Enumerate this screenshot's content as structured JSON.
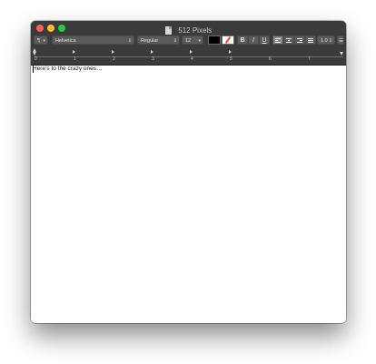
{
  "window": {
    "title": "512 Pixels",
    "title_icon": "document-icon"
  },
  "toolbar": {
    "paragraph_style_label": "¶",
    "font_family": "Helvetica",
    "font_style": "Regular",
    "font_size": "12",
    "text_color": "#000000",
    "background_color": "none",
    "bold_label": "B",
    "italic_label": "I",
    "underline_label": "U",
    "alignment_selected": "left",
    "line_spacing": "1.0",
    "list_style_icon": "list-icon"
  },
  "ruler": {
    "numbers": [
      "0",
      "1",
      "2",
      "3",
      "4",
      "5",
      "6",
      "7"
    ]
  },
  "document": {
    "text": "Here’s to the crazy ones…"
  },
  "colors": {
    "titlebar": "#3b3b3b",
    "close": "#fe5f57",
    "minimize": "#febc2e",
    "maximize": "#28c840"
  }
}
